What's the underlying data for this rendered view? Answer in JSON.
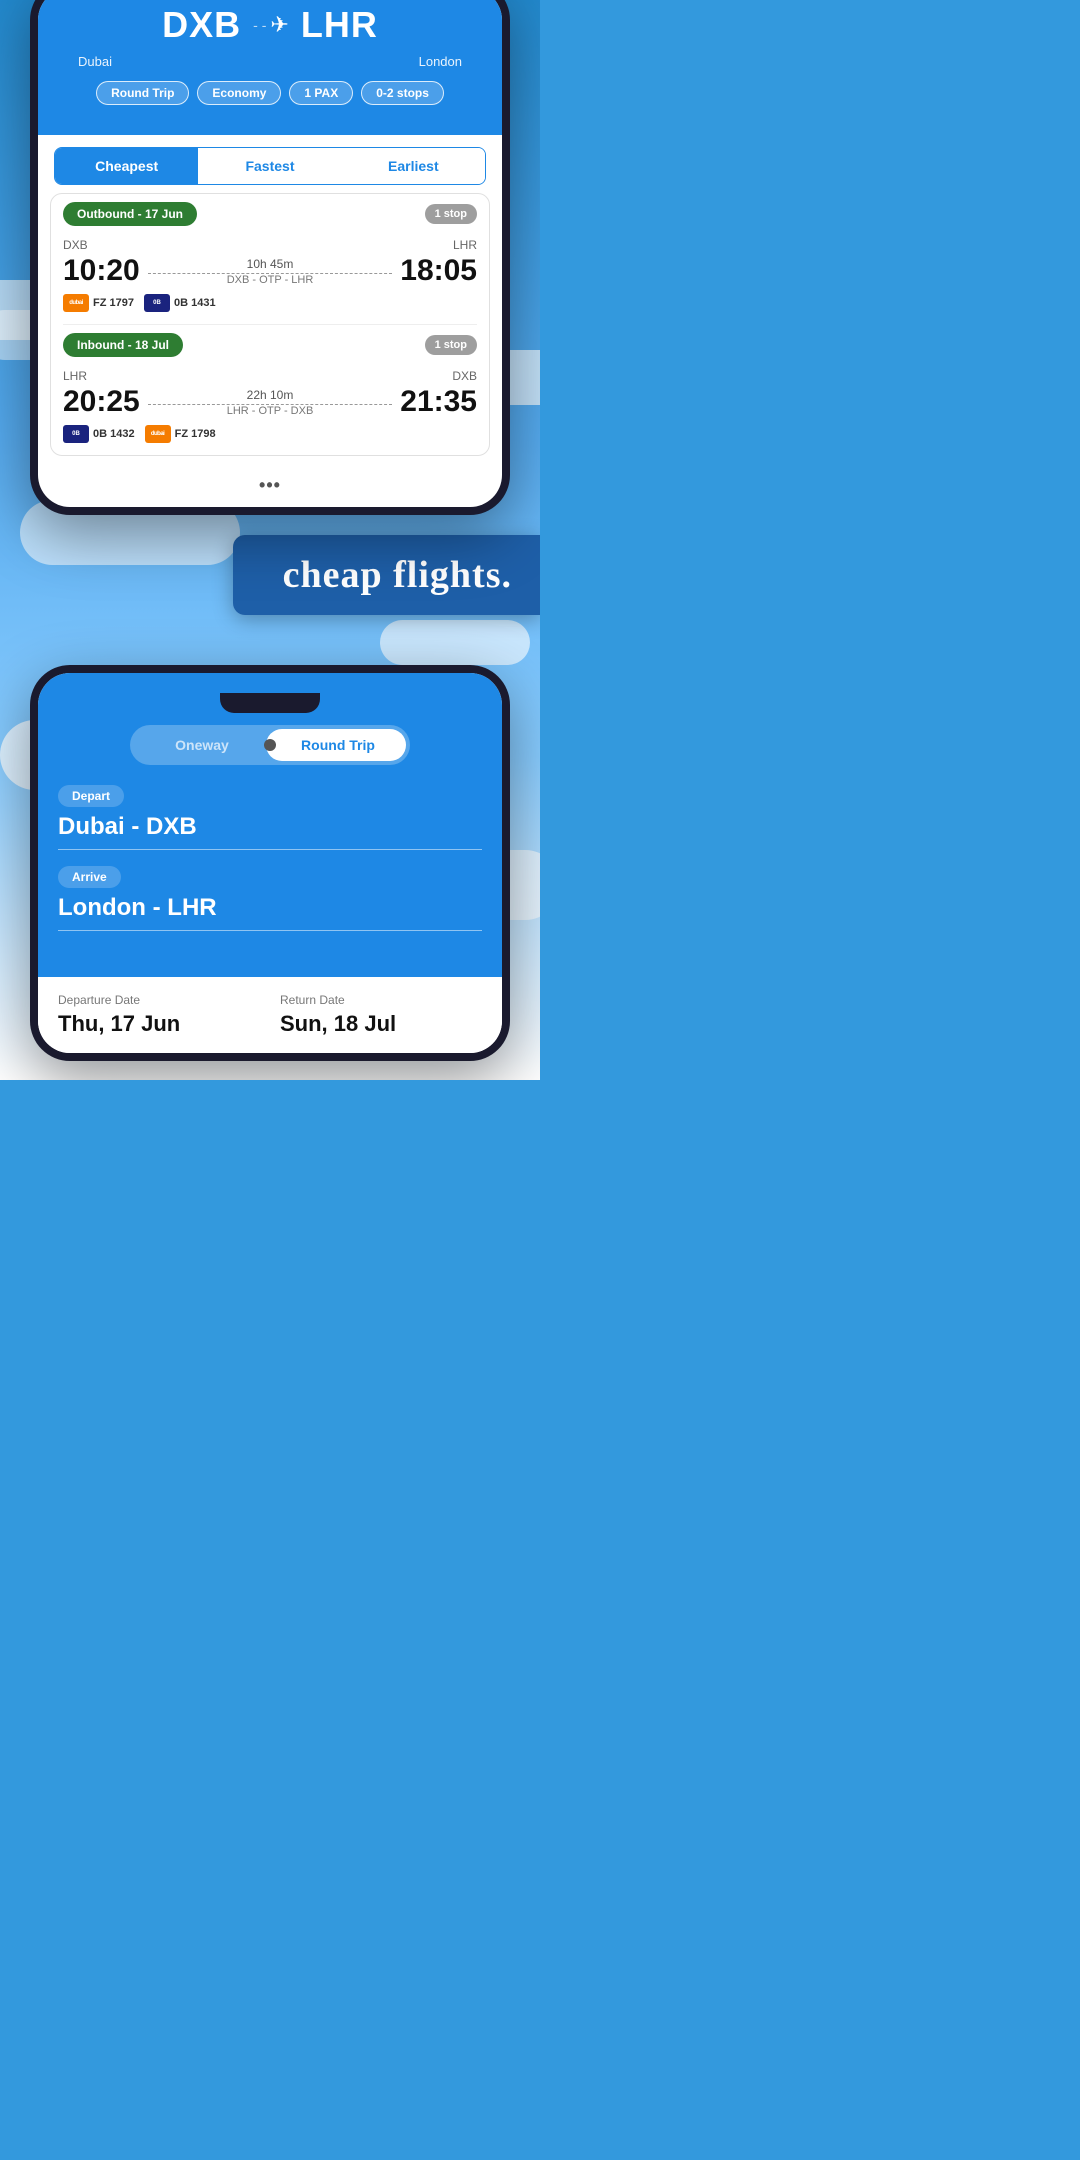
{
  "phone1": {
    "header": {
      "origin_code": "DXB",
      "origin_city": "Dubai",
      "destination_code": "LHR",
      "destination_city": "London",
      "airplane_icon": "✈",
      "pills": [
        "Round Trip",
        "Economy",
        "1 PAX",
        "0-2 stops"
      ]
    },
    "tabs": [
      {
        "label": "Cheapest",
        "active": true
      },
      {
        "label": "Fastest",
        "active": false
      },
      {
        "label": "Earliest",
        "active": false
      }
    ],
    "outbound": {
      "segment_label": "Outbound - 17 Jun",
      "stop_badge": "1 stop",
      "origin": "DXB",
      "destination": "LHR",
      "depart_time": "10:20",
      "arrive_time": "18:05",
      "duration": "10h 45m",
      "route": "DXB - OTP - LHR",
      "airlines": [
        {
          "code": "FZ 1797",
          "logo_type": "flydubai",
          "short": "dub"
        },
        {
          "code": "0B 1431",
          "logo_type": "blueair",
          "short": "0B"
        }
      ]
    },
    "inbound": {
      "segment_label": "Inbound - 18 Jul",
      "stop_badge": "1 stop",
      "origin": "LHR",
      "destination": "DXB",
      "depart_time": "20:25",
      "arrive_time": "21:35",
      "duration": "22h 10m",
      "route": "LHR - OTP - DXB",
      "airlines": [
        {
          "code": "0B 1432",
          "logo_type": "blueair",
          "short": "0B"
        },
        {
          "code": "FZ 1798",
          "logo_type": "flydubai",
          "short": "dub"
        }
      ]
    }
  },
  "middle": {
    "cheap_flights_text": "cheap flights."
  },
  "phone2": {
    "toggle": {
      "oneway_label": "Oneway",
      "roundtrip_label": "Round Trip",
      "active": "Round Trip"
    },
    "depart_label": "Depart",
    "depart_value": "Dubai - DXB",
    "arrive_label": "Arrive",
    "arrive_value": "London - LHR",
    "departure_date_label": "Departure Date",
    "departure_date_value": "Thu, 17 Jun",
    "return_date_label": "Return Date",
    "return_date_value": "Sun, 18 Jul"
  }
}
